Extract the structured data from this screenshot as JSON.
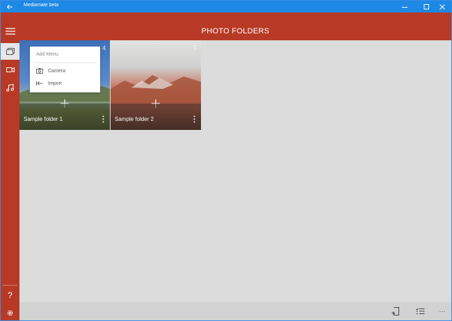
{
  "window": {
    "title": "Mediamate beta"
  },
  "header": {
    "title": "PHOTO FOLDERS"
  },
  "nav": {
    "items": [
      {
        "icon": "hamburger-menu-icon"
      },
      {
        "icon": "photos-icon",
        "active": true
      },
      {
        "icon": "video-camera-icon"
      },
      {
        "icon": "music-icon"
      }
    ],
    "help_label": "?",
    "settings_icon": "gear-icon"
  },
  "folders": [
    {
      "name": "Sample folder 1",
      "count": "4"
    },
    {
      "name": "Sample folder 2",
      "count": "7"
    }
  ],
  "add_menu": {
    "title": "Add Menu",
    "items": [
      {
        "label": "Camera",
        "icon": "camera-icon"
      },
      {
        "label": "Import",
        "icon": "import-icon"
      }
    ]
  },
  "command_bar": {
    "buttons": [
      "new-folder-icon",
      "select-list-icon",
      "more-icon"
    ],
    "more_label": "···"
  },
  "colors": {
    "accent": "#b83a26",
    "titlebar": "#1e88e5",
    "background": "#dcdcdc"
  }
}
